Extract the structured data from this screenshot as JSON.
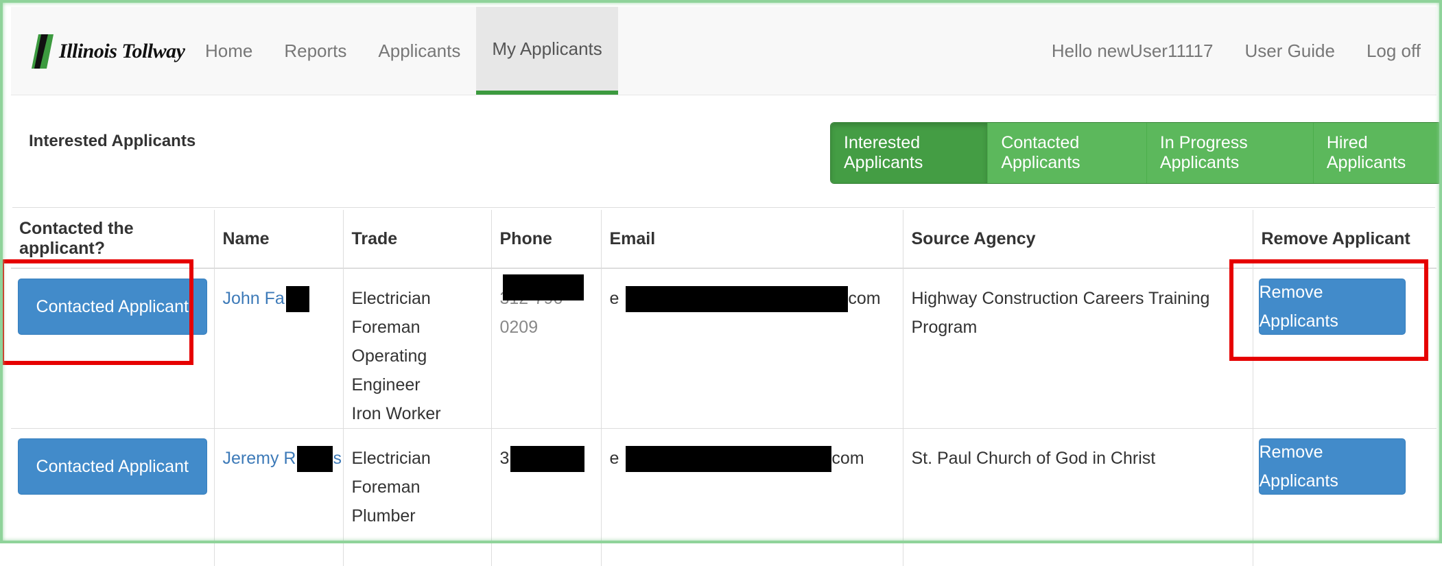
{
  "brand": {
    "name": "Illinois Tollway",
    "color": "#3c9a3f"
  },
  "nav": {
    "left": [
      {
        "label": "Home"
      },
      {
        "label": "Reports"
      },
      {
        "label": "Applicants"
      },
      {
        "label": "My Applicants",
        "active": true
      }
    ],
    "greeting": "Hello newUser11117",
    "user_guide": "User Guide",
    "log_off": "Log off"
  },
  "panel": {
    "title": "Interested Applicants",
    "tabs": [
      {
        "label": "Interested Applicants",
        "active": true
      },
      {
        "label": "Contacted Applicants"
      },
      {
        "label": "In Progress Applicants"
      },
      {
        "label": "Hired Applicants"
      }
    ]
  },
  "table": {
    "headers": [
      "Contacted the applicant?",
      "Name",
      "Trade",
      "Phone",
      "Email",
      "Source Agency",
      "Remove Applicant"
    ],
    "contacted_button": "Contacted Applicant",
    "remove_button": "Remove Applicants",
    "rows": [
      {
        "name": "John Fa",
        "trades": [
          "Electrician",
          "Foreman",
          "Operating Engineer",
          "Iron Worker"
        ],
        "phone": "312-796-0209",
        "email_prefix": "e",
        "email_suffix": "com",
        "agency": "Highway Construction Careers Training Program"
      },
      {
        "name_prefix": "Jeremy R",
        "name_suffix": "s",
        "trades": [
          "Electrician",
          "Foreman",
          "Plumber"
        ],
        "phone_prefix": "3",
        "email_prefix": "e",
        "email_suffix": "com",
        "agency": "St. Paul Church of God in Christ"
      }
    ]
  },
  "colors": {
    "primary_button": "#428bca",
    "tab_green": "#5cb85c",
    "tab_green_active": "#449d44",
    "highlight": "#e60000",
    "frame": "#8fd39a"
  }
}
